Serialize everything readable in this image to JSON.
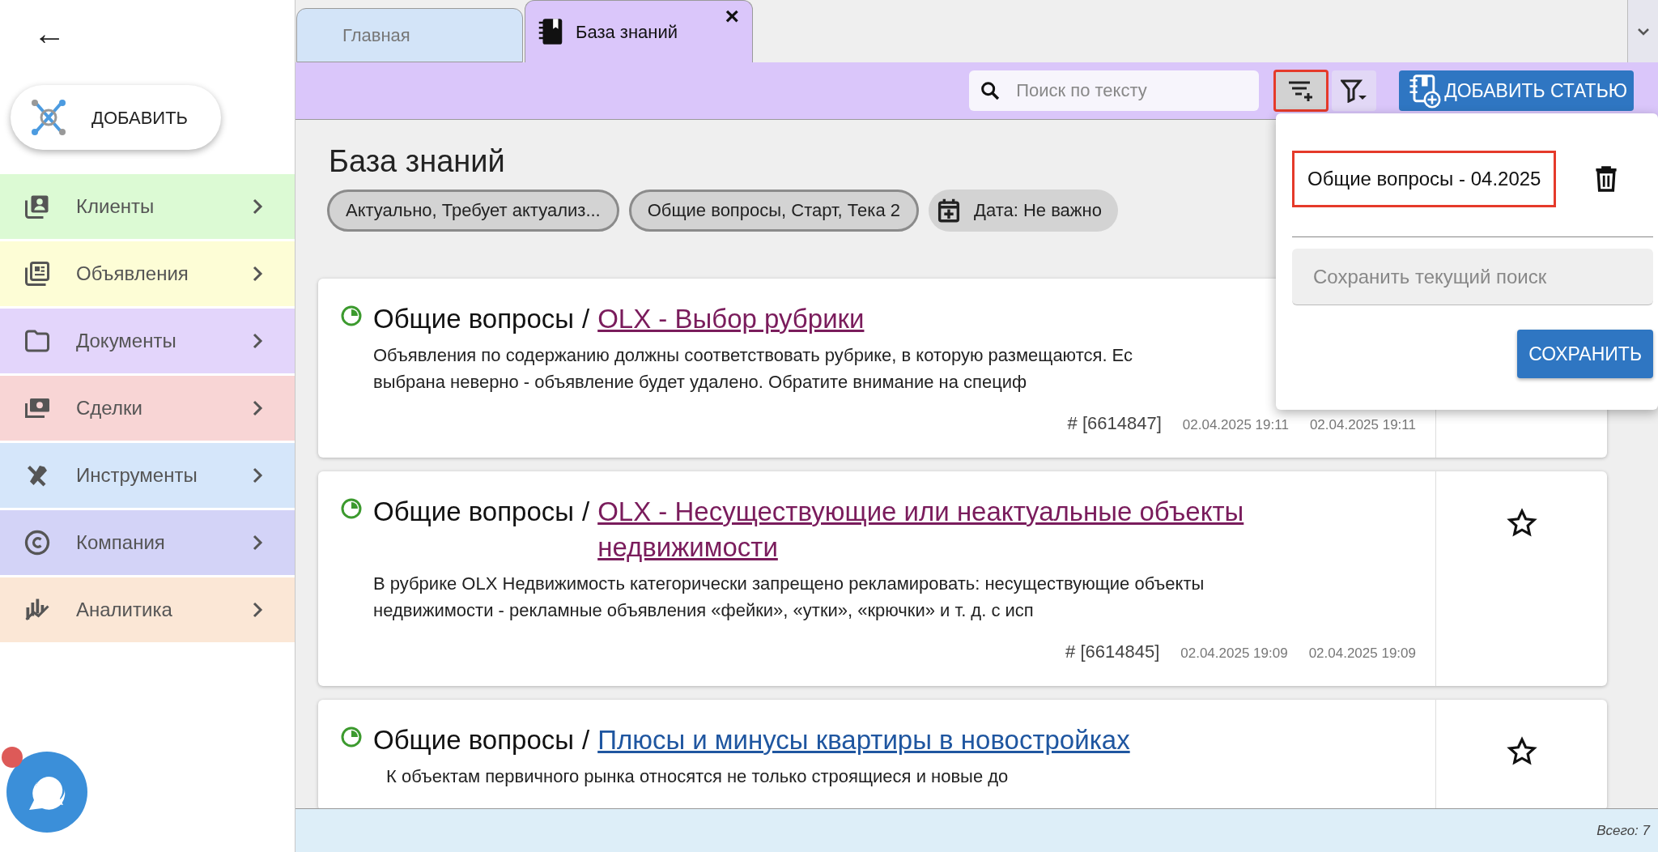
{
  "back_button": {
    "label": "←"
  },
  "add_button": {
    "label": "ДОБАВИТЬ"
  },
  "sidebar": {
    "items": [
      {
        "label": "Клиенты",
        "color": "#dcfad4"
      },
      {
        "label": "Объявления",
        "color": "#fdfdd6"
      },
      {
        "label": "Документы",
        "color": "#e3d5fb"
      },
      {
        "label": "Сделки",
        "color": "#f8d5d5"
      },
      {
        "label": "Инструменты",
        "color": "#d5e6fa"
      },
      {
        "label": "Компания",
        "color": "#d3d3f7"
      },
      {
        "label": "Аналитика",
        "color": "#fbe7d6"
      }
    ]
  },
  "chat": {
    "unread": true
  },
  "tabs": [
    {
      "label": "Главная",
      "selected": false
    },
    {
      "label": "База знаний",
      "selected": true,
      "close": "×"
    }
  ],
  "toolbar": {
    "search": {
      "placeholder": "Поиск по тексту"
    },
    "saved_filters_highlighted": true,
    "add_article": "ДОБАВИТЬ СТАТЬЮ"
  },
  "page": {
    "title": "База знаний",
    "chips": [
      {
        "kind": "outlined",
        "label": "Актуально, Требует актуализ..."
      },
      {
        "kind": "outlined",
        "label": "Общие вопросы, Старт, Тека 2"
      },
      {
        "kind": "date",
        "label": "Дата: Не важно"
      }
    ]
  },
  "cards": [
    {
      "category": "Общие вопросы",
      "separator": "/",
      "title": "OLX - Выбор рубрики",
      "visited": true,
      "text": "Объявления по содержанию должны соответствовать рубрике, в которую размещаются. Ес\nвыбрана неверно - объявление будет удалено. Обратите внимание на специф",
      "id": "# [6614847]",
      "created": "02.04.2025 19:11",
      "updated": "02.04.2025 19:11"
    },
    {
      "category": "Общие вопросы",
      "separator": "/",
      "title": "OLX - Несуществующие или неактуальные объекты недвижимости",
      "visited": true,
      "text": "В рубрике OLX Недвижимость категорически запрещено рекламировать: несуществующие объекты\nнедвижимости - рекламные объявления «фейки», «утки», «крючки» и т. д. с исп",
      "id": "# [6614845]",
      "created": "02.04.2025 19:09",
      "updated": "02.04.2025 19:09",
      "starred": false
    },
    {
      "category": "Общие вопросы",
      "separator": "/",
      "title": "Плюсы и минусы квартиры в новостройках",
      "visited": false,
      "text": "К объектам первичного рынка относятся не только строящиеся и новые до",
      "starred": false
    }
  ],
  "popup": {
    "saved_searches": [
      {
        "label": "Общие вопросы - 04.2025",
        "highlighted": true
      }
    ],
    "name_field": {
      "placeholder": "Сохранить текущий поиск"
    },
    "save_button": "СОХРАНИТЬ"
  },
  "status_bar": {
    "total": "Всего: 7"
  }
}
